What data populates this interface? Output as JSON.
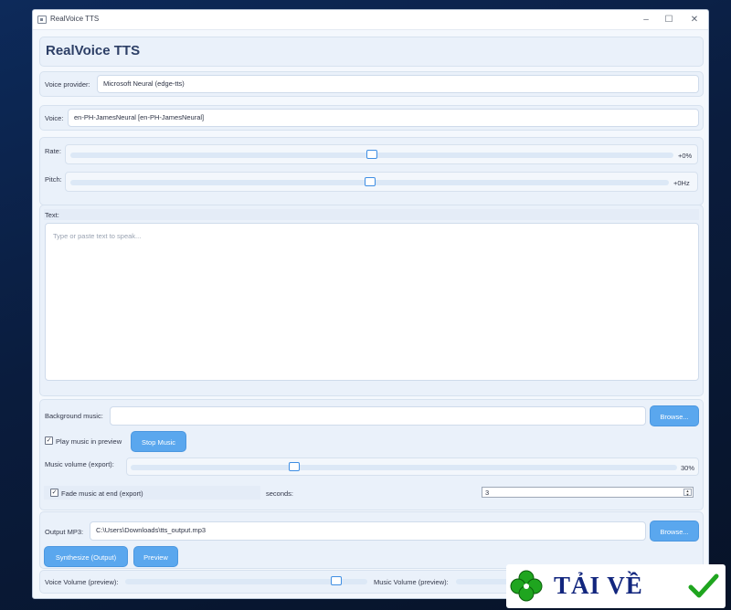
{
  "window": {
    "title": "RealVoice TTS"
  },
  "header": {
    "title": "RealVoice TTS"
  },
  "provider": {
    "label": "Voice provider:",
    "value": "Microsoft Neural (edge-tts)"
  },
  "voice": {
    "label": "Voice:",
    "value": "en-PH-JamesNeural  [en-PH-JamesNeural]"
  },
  "rate": {
    "label": "Rate:",
    "value_text": "+0%",
    "level": 0.5
  },
  "pitch": {
    "label": "Pitch:",
    "value_text": "+0Hz",
    "level": 0.5
  },
  "text": {
    "label": "Text:",
    "placeholder": "Type or paste text to speak..."
  },
  "music": {
    "bg_label": "Background music:",
    "bg_value": "",
    "browse_label": "Browse...",
    "play_in_preview_label": "Play music in preview",
    "play_in_preview_checked": true,
    "stop_label": "Stop Music",
    "volume_label": "Music volume (export):",
    "volume_text": "30%",
    "volume_level": 0.3,
    "fade_label": "Fade music at end (export)",
    "fade_checked": true,
    "seconds_label": "seconds:",
    "seconds_value": "3"
  },
  "output": {
    "label": "Output MP3:",
    "value": "C:\\Users\\Downloads\\tts_output.mp3",
    "browse_label": "Browse...",
    "synthesize_label": "Synthesize (Output)",
    "preview_label": "Preview"
  },
  "preview_bar": {
    "voice_volume_label": "Voice Volume (preview):",
    "voice_volume_level": 0.87,
    "music_volume_label": "Music Volume (preview):"
  },
  "watermark": {
    "text": "TẢI VỀ"
  },
  "colors": {
    "accent": "#5aa7ee",
    "background": "#0a1c3d",
    "watermark_text": "#12267e",
    "watermark_leaf": "#1fa51f"
  }
}
